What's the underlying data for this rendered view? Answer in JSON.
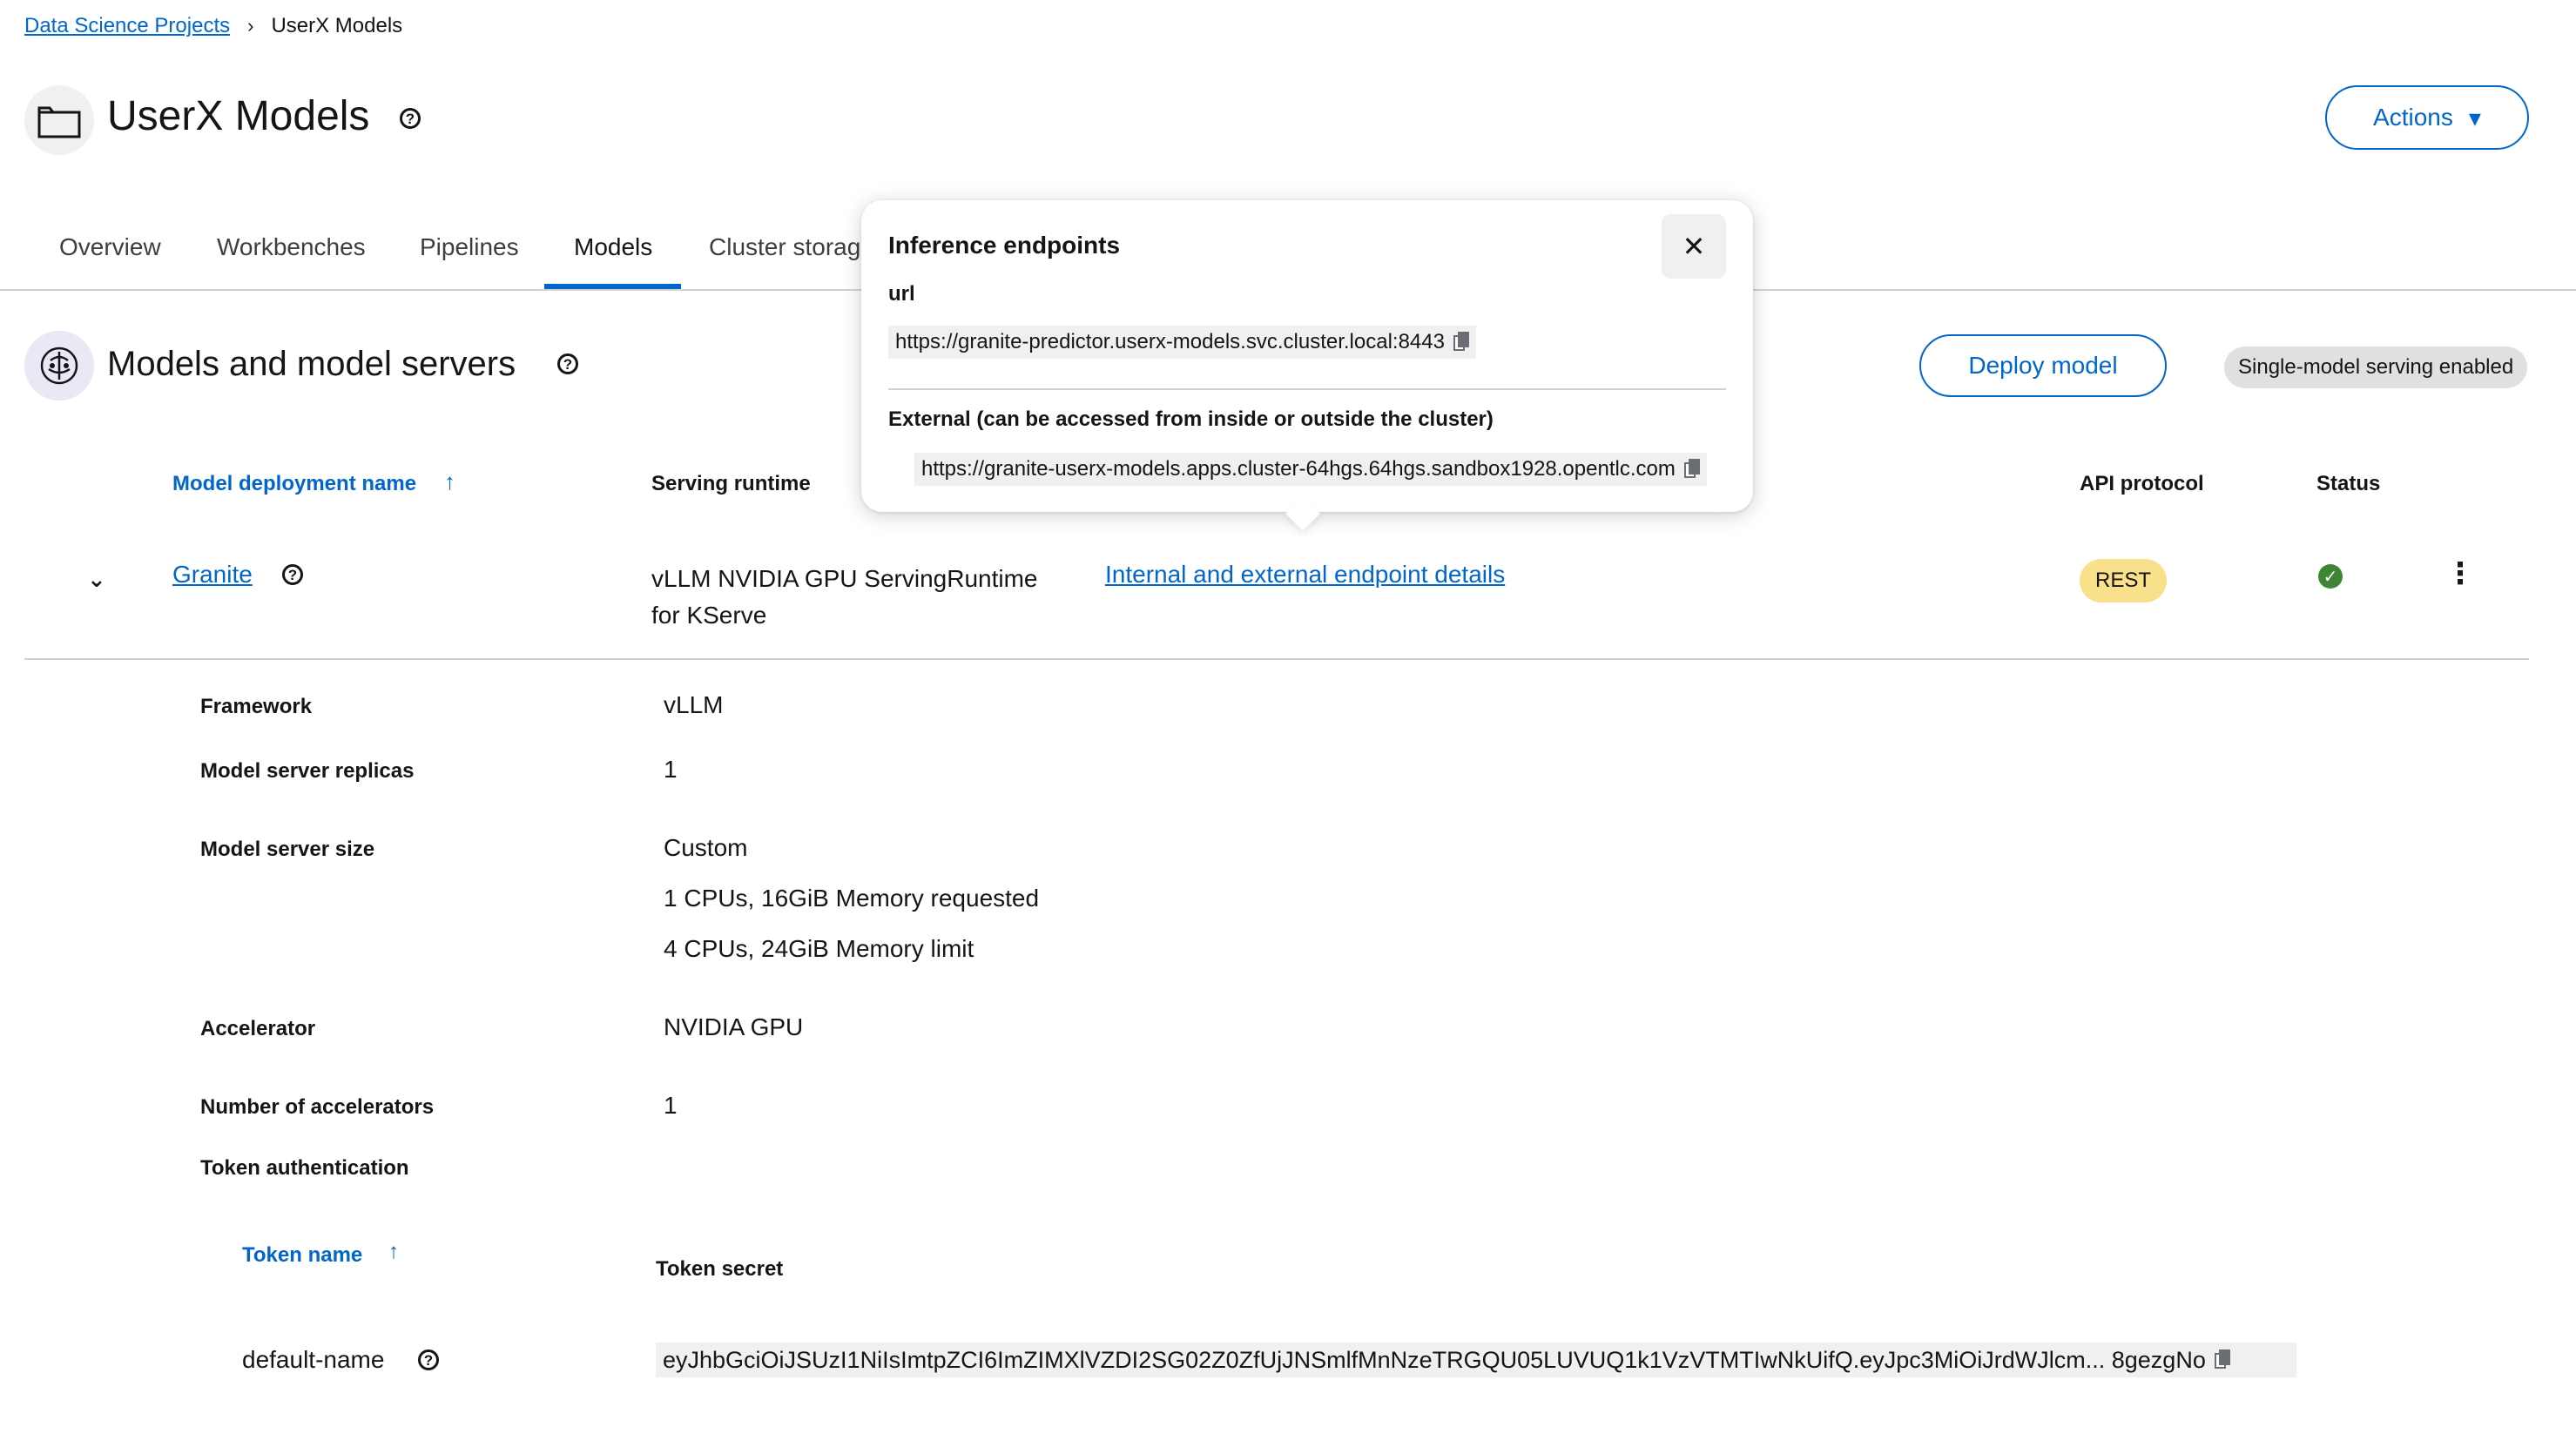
{
  "breadcrumb": {
    "parent": "Data Science Projects",
    "separator": "›",
    "current": "UserX Models"
  },
  "header": {
    "title": "UserX Models",
    "actions_label": "Actions",
    "actions_caret": "▾"
  },
  "tabs": [
    {
      "label": "Overview"
    },
    {
      "label": "Workbenches"
    },
    {
      "label": "Pipelines"
    },
    {
      "label": "Models",
      "active": true
    },
    {
      "label": "Cluster storag"
    }
  ],
  "section": {
    "title": "Models and model servers",
    "deploy_label": "Deploy model",
    "serving_badge": "Single-model serving enabled"
  },
  "table": {
    "headers": {
      "name": "Model deployment name",
      "runtime": "Serving runtime",
      "api": "API protocol",
      "status": "Status"
    },
    "sort_glyph": "↑",
    "row": {
      "toggle": "⌄",
      "name": "Granite",
      "runtime_line1": "vLLM NVIDIA GPU ServingRuntime",
      "runtime_line2": "for KServe",
      "endpoint_link": "Internal and external endpoint details",
      "api": "REST",
      "status_glyph": "✓",
      "kebab": "⋮"
    }
  },
  "details": {
    "framework_label": "Framework",
    "framework_value": "vLLM",
    "replicas_label": "Model server replicas",
    "replicas_value": "1",
    "size_label": "Model server size",
    "size_value1": "Custom",
    "size_value2": "1 CPUs, 16GiB Memory requested",
    "size_value3": "4 CPUs, 24GiB Memory limit",
    "accelerator_label": "Accelerator",
    "accelerator_value": "NVIDIA GPU",
    "num_accel_label": "Number of accelerators",
    "num_accel_value": "1",
    "token_auth_label": "Token authentication"
  },
  "tokens": {
    "name_header": "Token name",
    "secret_header": "Token secret",
    "row_name": "default-name",
    "row_secret": "eyJhbGciOiJSUzI1NiIsImtpZCI6ImZIMXlVZDI2SG02Z0ZfUjJNSmlfMnNzeTRGQU05LUVUQ1k1VzVTMTIwNkUifQ.eyJpc3MiOiJrdWJlcm... 8gezgNo"
  },
  "popover": {
    "title": "Inference endpoints",
    "close_glyph": "✕",
    "url_label": "url",
    "url_value": "https://granite-predictor.userx-models.svc.cluster.local:8443",
    "external_label": "External (can be accessed from inside or outside the cluster)",
    "external_value": "https://granite-userx-models.apps.cluster-64hgs.64hgs.sandbox1928.opentlc.com"
  }
}
